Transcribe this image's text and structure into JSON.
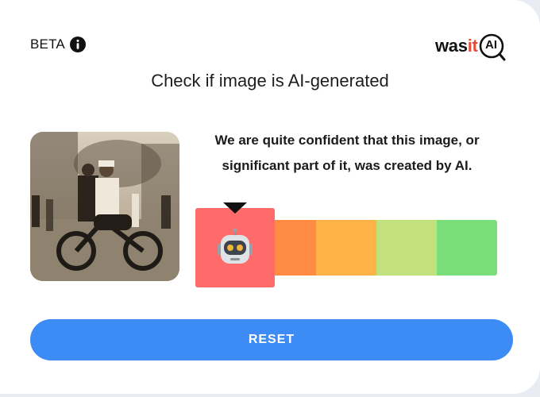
{
  "header": {
    "beta_label": "BETA",
    "beta_icon": "info-icon",
    "logo": {
      "was": "was",
      "it": "it",
      "ai": "AI"
    }
  },
  "title": "Check if image is AI-generated",
  "result": {
    "line1": "We are quite confident that this image, or",
    "line2": "significant part of it, was created by AI.",
    "scale": {
      "segments": [
        "#ff6b6b",
        "#ff8c42",
        "#ffb347",
        "#c2e07c",
        "#7adf78"
      ],
      "active_index": 0,
      "active_icon": "robot-icon"
    }
  },
  "thumbnail": {
    "icon": "uploaded-image"
  },
  "reset_label": "RESET",
  "colors": {
    "accent": "#3d8bf4",
    "logo_red": "#e94b39"
  }
}
